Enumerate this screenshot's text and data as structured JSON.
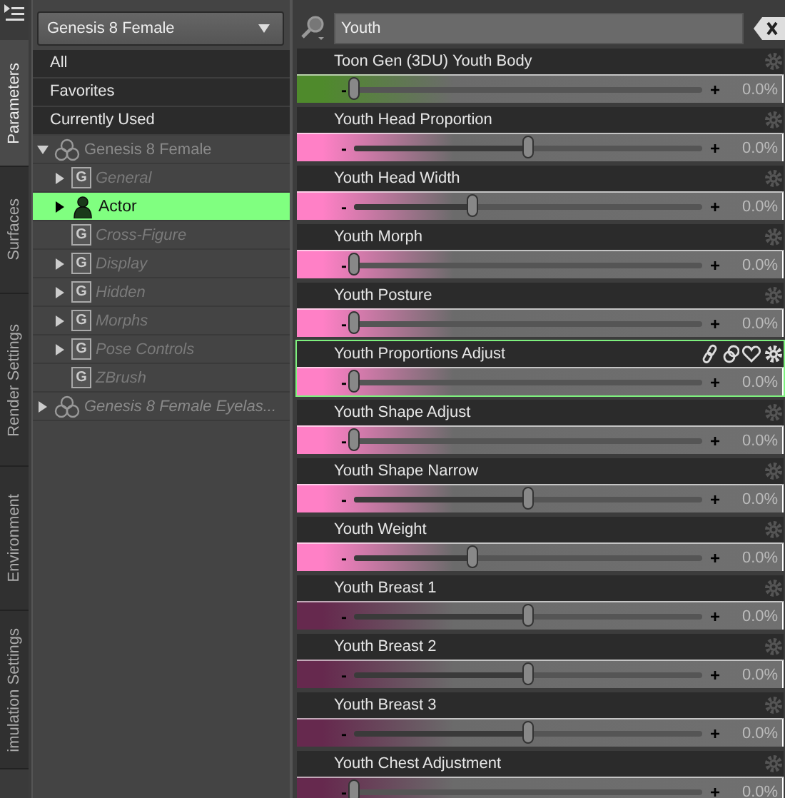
{
  "side_tabs": [
    {
      "label": "Parameters",
      "selected": true
    },
    {
      "label": "Surfaces",
      "selected": false
    },
    {
      "label": "Render Settings",
      "selected": false
    },
    {
      "label": "Environment",
      "selected": false
    },
    {
      "label": "imulation Settings",
      "selected": false
    }
  ],
  "figure_select": {
    "value": "Genesis 8 Female"
  },
  "filters": [
    {
      "label": "All"
    },
    {
      "label": "Favorites"
    },
    {
      "label": "Currently Used"
    }
  ],
  "tree": [
    {
      "label": "Genesis 8 Female",
      "kind": "figure",
      "expanded": true,
      "italic": false,
      "selected": false,
      "children": [
        {
          "label": "General",
          "kind": "group",
          "badge": "G",
          "expanded": false,
          "italic": true,
          "selected": false
        },
        {
          "label": "Actor",
          "kind": "actor",
          "expanded": false,
          "italic": false,
          "selected": true
        },
        {
          "label": "Cross-Figure",
          "kind": "group",
          "badge": "G",
          "italic": true,
          "selected": false
        },
        {
          "label": "Display",
          "kind": "group",
          "badge": "G",
          "expanded": false,
          "italic": true,
          "selected": false
        },
        {
          "label": "Hidden",
          "kind": "group",
          "badge": "G",
          "expanded": false,
          "italic": true,
          "selected": false
        },
        {
          "label": "Morphs",
          "kind": "group",
          "badge": "G",
          "expanded": false,
          "italic": true,
          "selected": false
        },
        {
          "label": "Pose Controls",
          "kind": "group",
          "badge": "G",
          "expanded": false,
          "italic": true,
          "selected": false
        },
        {
          "label": "ZBrush",
          "kind": "group",
          "badge": "G",
          "italic": true,
          "selected": false
        }
      ]
    },
    {
      "label": "Genesis 8 Female Eyelas...",
      "kind": "figure",
      "expanded": false,
      "italic": true,
      "selected": false
    }
  ],
  "search": {
    "value": "Youth"
  },
  "params": [
    {
      "name": "Toon Gen (3DU) Youth Body",
      "color": "#4f8a2c",
      "level": 0,
      "reading": "0.0%",
      "selected": false
    },
    {
      "name": "Youth Head Proportion",
      "color": "#ff80c6",
      "level": 0.5,
      "reading": "0.0%",
      "selected": false
    },
    {
      "name": "Youth Head Width",
      "color": "#ff80c6",
      "level": 0.34,
      "reading": "0.0%",
      "selected": false
    },
    {
      "name": "Youth Morph",
      "color": "#ff80c6",
      "level": 0,
      "reading": "0.0%",
      "selected": false
    },
    {
      "name": "Youth Posture",
      "color": "#ff80c6",
      "level": 0,
      "reading": "0.0%",
      "selected": false
    },
    {
      "name": "Youth Proportions Adjust",
      "color": "#ff80c6",
      "level": 0,
      "reading": "0.0%",
      "selected": true
    },
    {
      "name": "Youth Shape Adjust",
      "color": "#ff80c6",
      "level": 0,
      "reading": "0.0%",
      "selected": false
    },
    {
      "name": "Youth Shape Narrow",
      "color": "#ff80c6",
      "level": 0.5,
      "reading": "0.0%",
      "selected": false
    },
    {
      "name": "Youth Weight",
      "color": "#ff80c6",
      "level": 0.34,
      "reading": "0.0%",
      "selected": false
    },
    {
      "name": "Youth Breast 1",
      "color": "#66294e",
      "level": 0.5,
      "reading": "0.0%",
      "selected": false
    },
    {
      "name": "Youth Breast 2",
      "color": "#66294e",
      "level": 0.5,
      "reading": "0.0%",
      "selected": false
    },
    {
      "name": "Youth Breast 3",
      "color": "#66294e",
      "level": 0.5,
      "reading": "0.0%",
      "selected": false
    },
    {
      "name": "Youth Chest Adjustment",
      "color": "#66294e",
      "level": 0,
      "reading": "0.0%",
      "selected": false
    }
  ],
  "slider_marks": {
    "minus": "-",
    "plus": "+"
  }
}
